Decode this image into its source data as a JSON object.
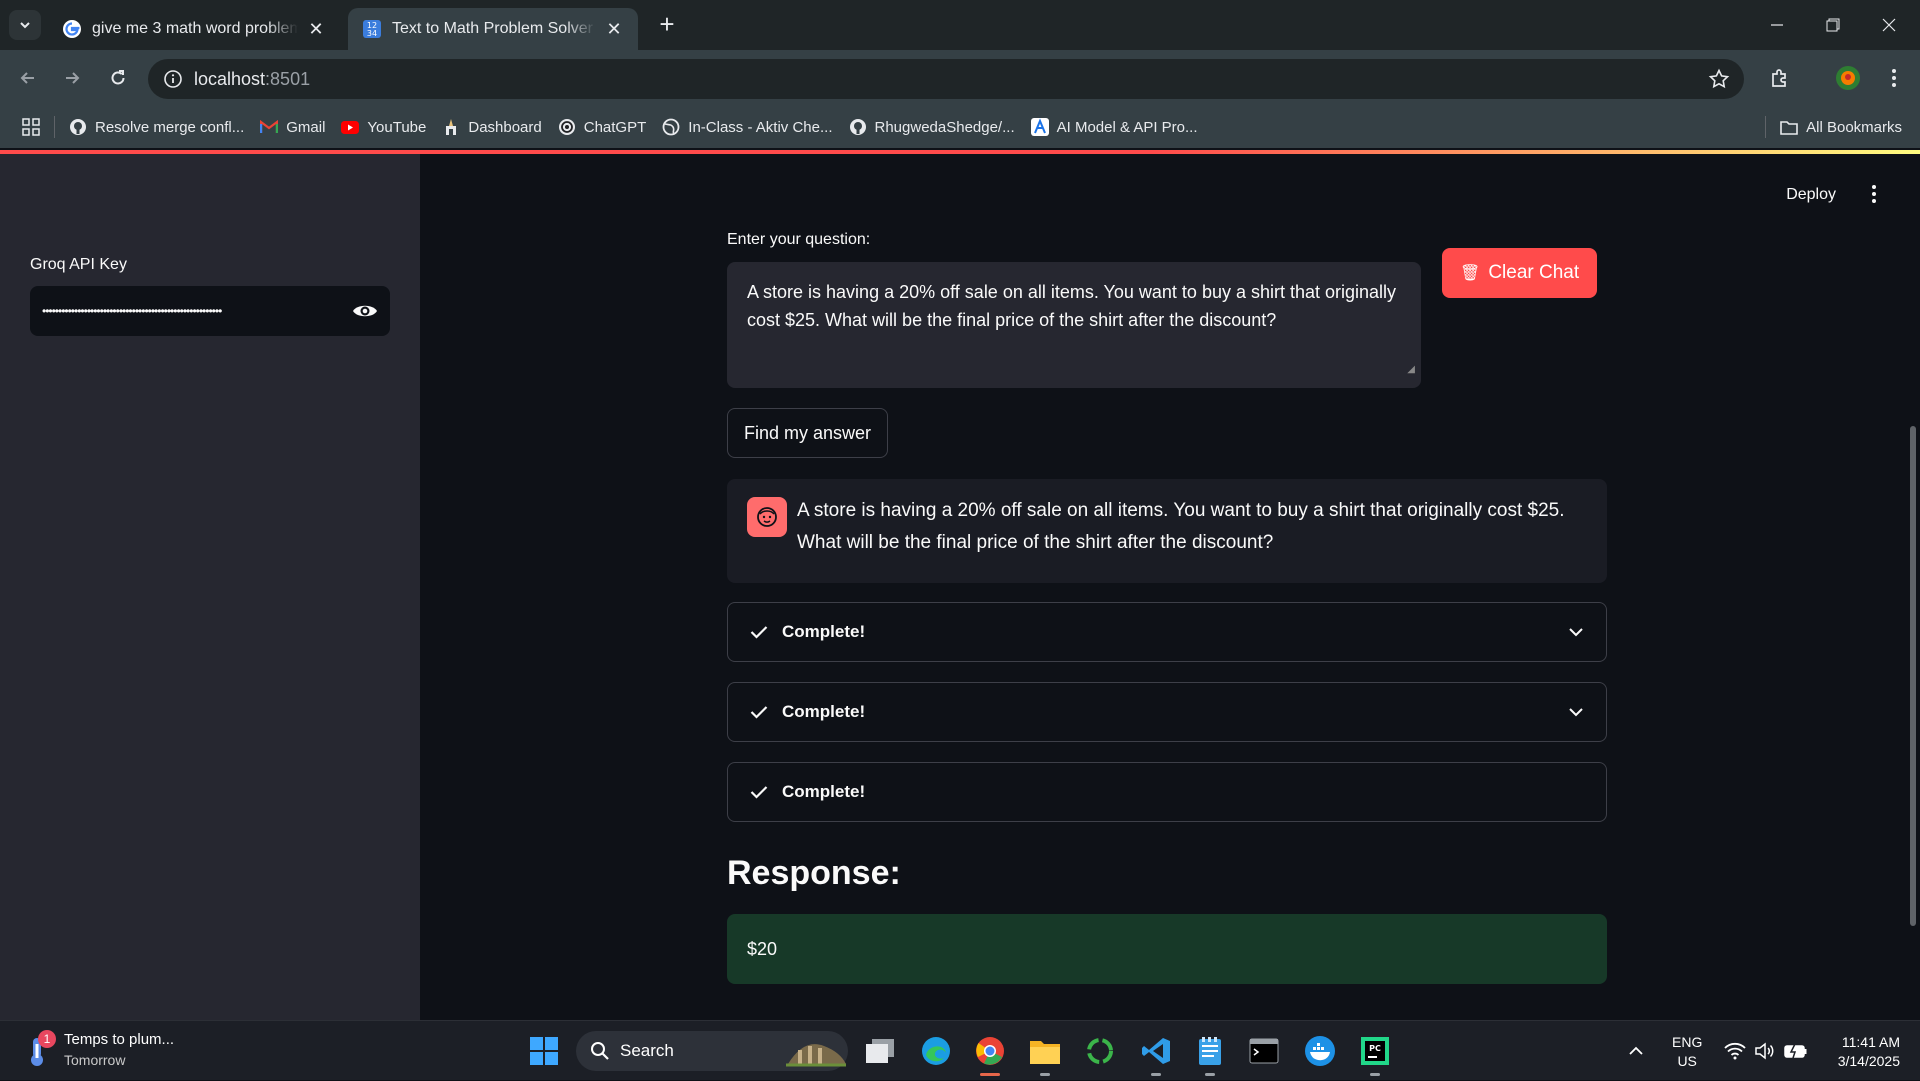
{
  "browser": {
    "tabs": [
      {
        "title": "give me 3 math word problem",
        "active": false
      },
      {
        "title": "Text to Math Problem Solver an",
        "active": true
      }
    ],
    "url_host": "localhost",
    "url_port": ":8501",
    "bookmarks": [
      {
        "label": "Resolve merge confl...",
        "icon": "github-icon"
      },
      {
        "label": "Gmail",
        "icon": "gmail-icon"
      },
      {
        "label": "YouTube",
        "icon": "youtube-icon"
      },
      {
        "label": "Dashboard",
        "icon": "dashboard-icon"
      },
      {
        "label": "ChatGPT",
        "icon": "chatgpt-icon"
      },
      {
        "label": "In-Class - Aktiv Che...",
        "icon": "globe-icon"
      },
      {
        "label": "RhugwedaShedge/...",
        "icon": "github-icon"
      },
      {
        "label": "AI Model & API Pro...",
        "icon": "ai-model-icon"
      }
    ],
    "all_bookmarks": "All Bookmarks"
  },
  "sidebar": {
    "api_key_label": "Groq API Key",
    "api_key_masked": "••••••••••••••••••••••••••••••••••••••••••••••••••••••••"
  },
  "header": {
    "deploy": "Deploy"
  },
  "main": {
    "question_label": "Enter your question:",
    "question_value": "A store is having a 20% off sale on all items. You want to buy a shirt that originally cost $25. What will be the final price of the shirt after the discount?",
    "clear_button": "Clear Chat",
    "find_button": "Find my answer",
    "chat_message": "A store is having a 20% off sale on all items. You want to buy a shirt that originally cost $25. What will be the final price of the shirt after the discount?",
    "steps": [
      {
        "label": "Complete!",
        "expandable": true
      },
      {
        "label": "Complete!",
        "expandable": true
      },
      {
        "label": "Complete!",
        "expandable": false
      }
    ],
    "response_heading": "Response:",
    "response_value": "$20"
  },
  "taskbar": {
    "weather_title": "Temps to plum...",
    "weather_sub": "Tomorrow",
    "weather_badge": "1",
    "search": "Search",
    "lang_1": "ENG",
    "lang_2": "US",
    "time": "11:41 AM",
    "date": "3/14/2025"
  },
  "colors": {
    "accent": "#ff4b4b",
    "app_bg": "#0e1117",
    "sidebar_bg": "#262730",
    "success_bg": "#173928"
  }
}
